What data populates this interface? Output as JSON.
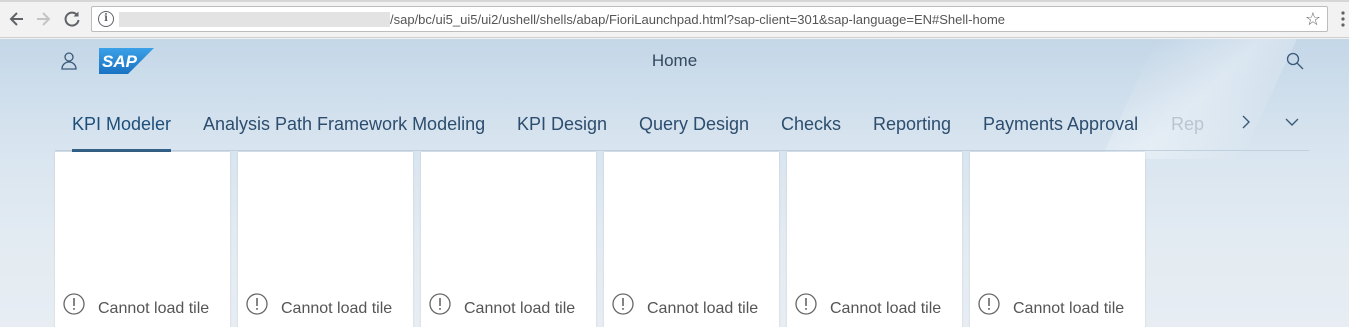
{
  "browser": {
    "url_path": "/sap/bc/ui5_ui5/ui2/ushell/shells/abap/FioriLaunchpad.html?sap-client=301&sap-language=EN#Shell-home",
    "icons": {
      "back": "arrow-left-icon",
      "forward": "arrow-right-icon",
      "reload": "reload-icon",
      "info": "info-icon",
      "bookmark": "star-icon",
      "menu": "more-vert-icon"
    }
  },
  "shell": {
    "title": "Home",
    "logo_text": "SAP",
    "icons": {
      "user": "user-icon",
      "search": "search-icon"
    },
    "colors": {
      "logo_blue": "#1a7fd4",
      "tab_underline": "#346187"
    }
  },
  "tabs": [
    {
      "label": "KPI Modeler",
      "active": true
    },
    {
      "label": "Analysis Path Framework Modeling",
      "active": false
    },
    {
      "label": "KPI Design",
      "active": false
    },
    {
      "label": "Query Design",
      "active": false
    },
    {
      "label": "Checks",
      "active": false
    },
    {
      "label": "Reporting",
      "active": false
    },
    {
      "label": "Payments Approval",
      "active": false
    },
    {
      "label": "Rep",
      "active": false
    }
  ],
  "tiles": [
    {
      "status_text": "Cannot load tile"
    },
    {
      "status_text": "Cannot load tile"
    },
    {
      "status_text": "Cannot load tile"
    },
    {
      "status_text": "Cannot load tile"
    },
    {
      "status_text": "Cannot load tile"
    },
    {
      "status_text": "Cannot load tile"
    }
  ]
}
